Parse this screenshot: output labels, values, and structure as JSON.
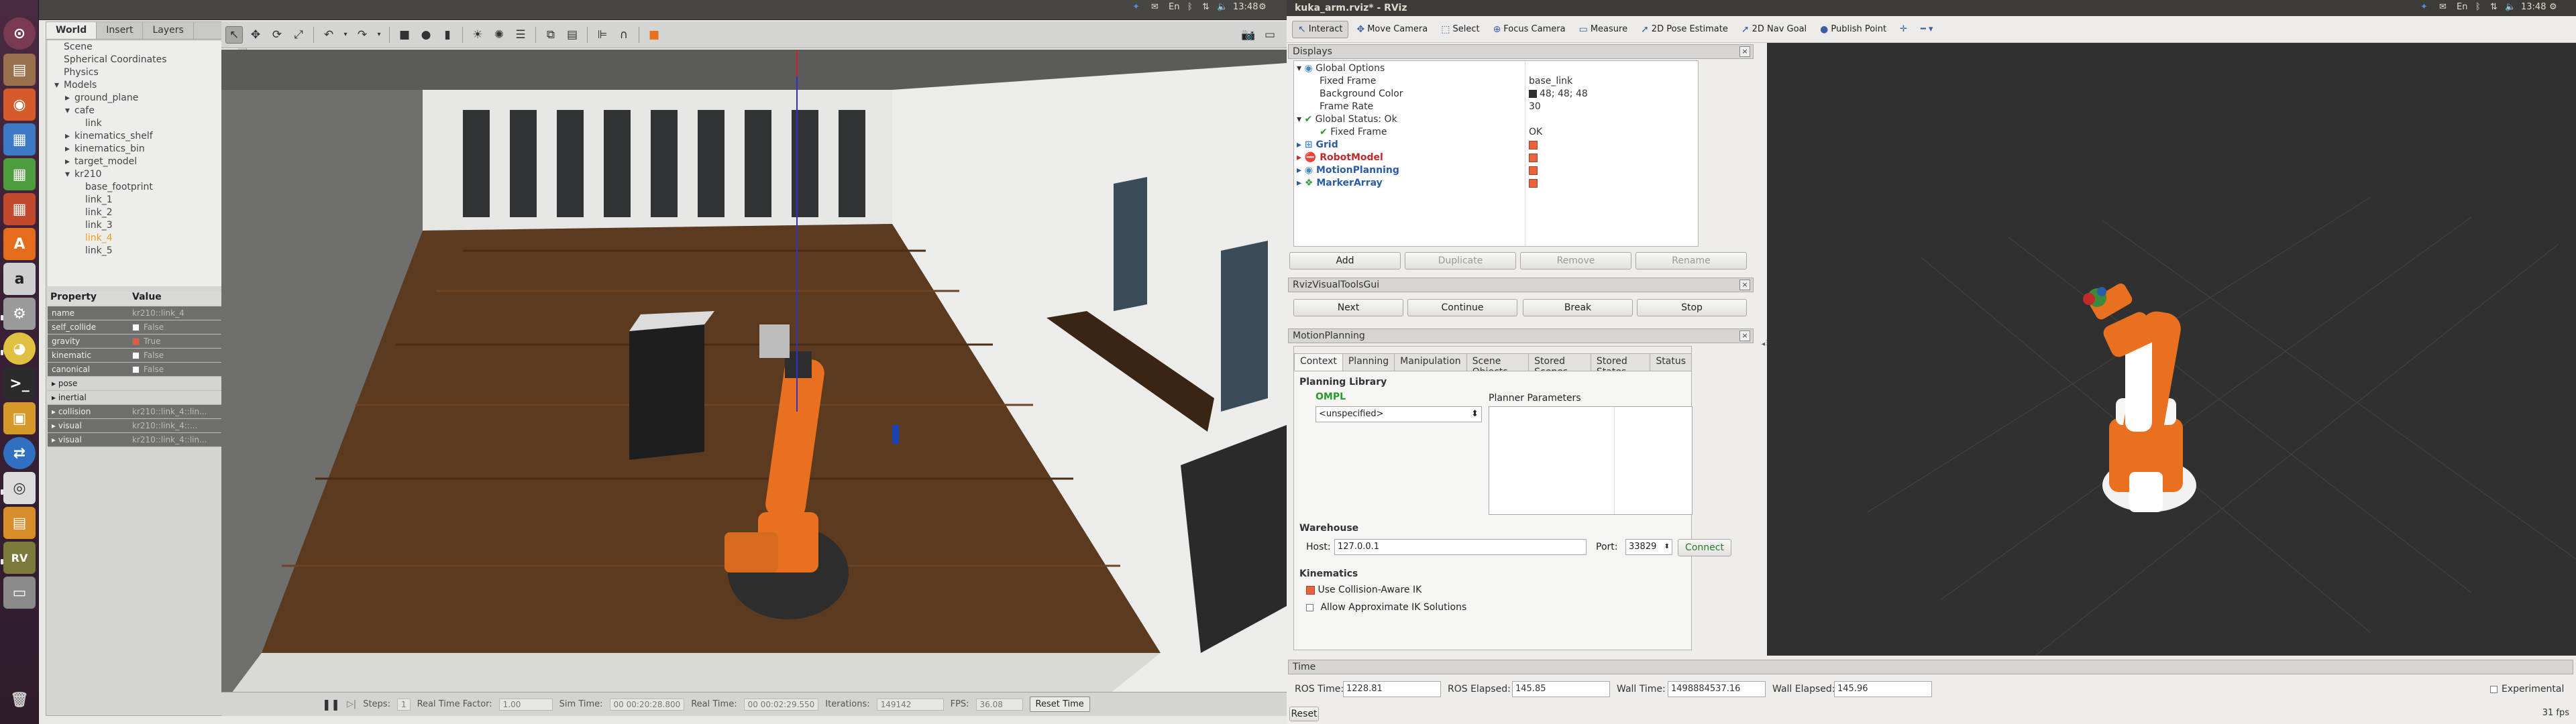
{
  "gazebo": {
    "tabs": [
      "World",
      "Insert",
      "Layers"
    ],
    "tree": [
      {
        "label": "Scene",
        "indent": 0,
        "arrow": ""
      },
      {
        "label": "Spherical Coordinates",
        "indent": 0,
        "arrow": ""
      },
      {
        "label": "Physics",
        "indent": 0,
        "arrow": ""
      },
      {
        "label": "Models",
        "indent": 0,
        "arrow": "▾"
      },
      {
        "label": "ground_plane",
        "indent": 1,
        "arrow": "▸"
      },
      {
        "label": "cafe",
        "indent": 1,
        "arrow": "▾"
      },
      {
        "label": "link",
        "indent": 2,
        "arrow": ""
      },
      {
        "label": "kinematics_shelf",
        "indent": 1,
        "arrow": "▸"
      },
      {
        "label": "kinematics_bin",
        "indent": 1,
        "arrow": "▸"
      },
      {
        "label": "target_model",
        "indent": 1,
        "arrow": "▸"
      },
      {
        "label": "kr210",
        "indent": 1,
        "arrow": "▾"
      },
      {
        "label": "base_footprint",
        "indent": 2,
        "arrow": ""
      },
      {
        "label": "link_1",
        "indent": 2,
        "arrow": ""
      },
      {
        "label": "link_2",
        "indent": 2,
        "arrow": ""
      },
      {
        "label": "link_3",
        "indent": 2,
        "arrow": ""
      },
      {
        "label": "link_4",
        "indent": 2,
        "arrow": "",
        "selected": true
      },
      {
        "label": "link_5",
        "indent": 2,
        "arrow": ""
      }
    ],
    "property_header": {
      "property": "Property",
      "value": "Value"
    },
    "properties": [
      {
        "key": "name",
        "value": "kr210::link_4",
        "dark": true
      },
      {
        "key": "self_collide",
        "value": "False",
        "check": false,
        "dark": true
      },
      {
        "key": "gravity",
        "value": "True",
        "check": true,
        "dark": true
      },
      {
        "key": "kinematic",
        "value": "False",
        "check": false,
        "dark": true
      },
      {
        "key": "canonical",
        "value": "False",
        "check": false,
        "dark": true
      },
      {
        "key": "▸ pose",
        "value": "",
        "dark": false
      },
      {
        "key": "▸ inertial",
        "value": "",
        "dark": false
      },
      {
        "key": "▸ collision",
        "value": "kr210::link_4::lin...",
        "dark": true
      },
      {
        "key": "▸ visual",
        "value": "kr210::link_4::...",
        "dark": true
      },
      {
        "key": "▸ visual",
        "value": "kr210::link_4::lin...",
        "dark": true
      }
    ],
    "bottom": {
      "steps_label": "Steps:",
      "steps_value": "1",
      "rtf_label": "Real Time Factor:",
      "rtf_value": "1.00",
      "sim_label": "Sim Time:",
      "sim_value": "00 00:20:28.800",
      "real_label": "Real Time:",
      "real_value": "00 00:02:29.550",
      "iter_label": "Iterations:",
      "iter_value": "149142",
      "fps_label": "FPS:",
      "fps_value": "36.08",
      "reset_label": "Reset Time"
    }
  },
  "rviz": {
    "window_title": "kuka_arm.rviz* - RViz",
    "tools": [
      {
        "label": "Interact",
        "icon": "↖",
        "active": true
      },
      {
        "label": "Move Camera",
        "icon": "✥"
      },
      {
        "label": "Select",
        "icon": "⬚"
      },
      {
        "label": "Focus Camera",
        "icon": "⊕"
      },
      {
        "label": "Measure",
        "icon": "▭"
      },
      {
        "label": "2D Pose Estimate",
        "icon": "➚"
      },
      {
        "label": "2D Nav Goal",
        "icon": "➚"
      },
      {
        "label": "Publish Point",
        "icon": "●"
      }
    ],
    "displays_title": "Displays",
    "displays": {
      "global_options": "Global Options",
      "fixed_frame_label": "Fixed Frame",
      "fixed_frame_value": "base_link",
      "bg_label": "Background Color",
      "bg_value": "48; 48; 48",
      "frame_rate_label": "Frame Rate",
      "frame_rate_value": "30",
      "global_status": "Global Status: Ok",
      "status_ff_label": "Fixed Frame",
      "status_ff_value": "OK",
      "grid": "Grid",
      "robot_model": "RobotModel",
      "motion_planning": "MotionPlanning",
      "marker_array": "MarkerArray"
    },
    "display_buttons": {
      "add": "Add",
      "duplicate": "Duplicate",
      "remove": "Remove",
      "rename": "Rename"
    },
    "rvt_title": "RvizVisualToolsGui",
    "rvt_buttons": {
      "next": "Next",
      "continue": "Continue",
      "break": "Break",
      "stop": "Stop"
    },
    "mp_title": "MotionPlanning",
    "mp_tabs": [
      "Context",
      "Planning",
      "Manipulation",
      "Scene Objects",
      "Stored Scenes",
      "Stored States",
      "Status"
    ],
    "mp": {
      "planning_library": "Planning Library",
      "ompl": "OMPL",
      "planner_select": "<unspecified>",
      "planner_params": "Planner Parameters",
      "warehouse": "Warehouse",
      "host_label": "Host:",
      "host_value": "127.0.0.1",
      "port_label": "Port:",
      "port_value": "33829",
      "connect": "Connect",
      "kinematics": "Kinematics",
      "collision_ik": "Use Collision-Aware IK",
      "approx_ik": "Allow Approximate IK Solutions"
    },
    "time": {
      "title": "Time",
      "ros_time_label": "ROS Time:",
      "ros_time": "1228.81",
      "ros_elapsed_label": "ROS Elapsed:",
      "ros_elapsed": "145.85",
      "wall_time_label": "Wall Time:",
      "wall_time": "1498884537.16",
      "wall_elapsed_label": "Wall Elapsed:",
      "wall_elapsed": "145.96",
      "experimental": "Experimental",
      "reset": "Reset",
      "fps": "31 fps"
    }
  },
  "system": {
    "clock": "13:48"
  },
  "colors": {
    "robot_orange": "#e8701f",
    "rviz_bg": "#303030",
    "floor": "#5b3a20",
    "selection": "#f29b1d"
  }
}
